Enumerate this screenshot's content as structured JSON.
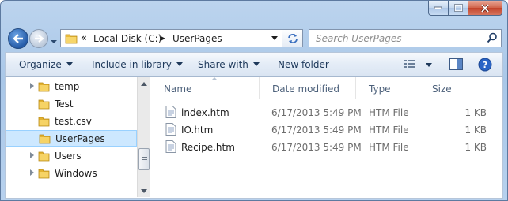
{
  "window": {
    "accent": "#a9c7e8"
  },
  "breadcrumb": {
    "overflow": "«",
    "drive": "Local Disk (C:)",
    "sep": "▸",
    "folder": "UserPages"
  },
  "search": {
    "placeholder": "Search UserPages"
  },
  "toolbar": {
    "organize": "Organize",
    "include": "Include in library",
    "share": "Share with",
    "new_folder": "New folder"
  },
  "nav": {
    "items": [
      {
        "label": "temp",
        "expandable": true,
        "selected": false
      },
      {
        "label": "Test",
        "expandable": false,
        "selected": false
      },
      {
        "label": "test.csv",
        "expandable": false,
        "selected": false
      },
      {
        "label": "UserPages",
        "expandable": false,
        "selected": true
      },
      {
        "label": "Users",
        "expandable": true,
        "selected": false
      },
      {
        "label": "Windows",
        "expandable": true,
        "selected": false
      }
    ]
  },
  "columns": {
    "name": "Name",
    "date": "Date modified",
    "type": "Type",
    "size": "Size"
  },
  "files": [
    {
      "name": "index.htm",
      "date": "6/17/2013 5:49 PM",
      "type": "HTM File",
      "size": "1 KB"
    },
    {
      "name": "IO.htm",
      "date": "6/17/2013 5:49 PM",
      "type": "HTM File",
      "size": "1 KB"
    },
    {
      "name": "Recipe.htm",
      "date": "6/17/2013 5:49 PM",
      "type": "HTM File",
      "size": "1 KB"
    }
  ]
}
